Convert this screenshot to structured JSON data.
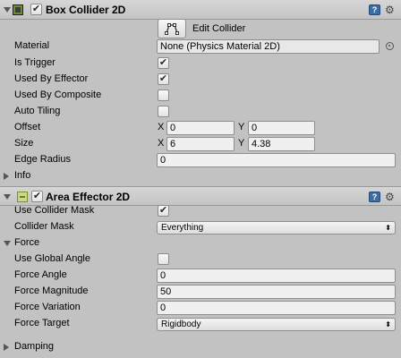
{
  "box_collider": {
    "title": "Box Collider 2D",
    "enabled_check": "✔",
    "edit_collider_label": "Edit Collider",
    "material_label": "Material",
    "material_value": "None (Physics Material 2D)",
    "is_trigger_label": "Is Trigger",
    "is_trigger_check": "✔",
    "used_by_effector_label": "Used By Effector",
    "used_by_effector_check": "✔",
    "used_by_composite_label": "Used By Composite",
    "auto_tiling_label": "Auto Tiling",
    "offset_label": "Offset",
    "offset_x": "0",
    "offset_y": "0",
    "size_label": "Size",
    "size_x": "6",
    "size_y": "4.38",
    "edge_radius_label": "Edge Radius",
    "edge_radius_value": "0",
    "info_label": "Info",
    "axis_x": "X",
    "axis_y": "Y"
  },
  "area_effector": {
    "title": "Area Effector 2D",
    "enabled_check": "✔",
    "use_collider_mask_label": "Use Collider Mask",
    "use_collider_mask_check": "✔",
    "collider_mask_label": "Collider Mask",
    "collider_mask_value": "Everything",
    "force_label": "Force",
    "use_global_angle_label": "Use Global Angle",
    "force_angle_label": "Force Angle",
    "force_angle_value": "0",
    "force_magnitude_label": "Force Magnitude",
    "force_magnitude_value": "50",
    "force_variation_label": "Force Variation",
    "force_variation_value": "0",
    "force_target_label": "Force Target",
    "force_target_value": "Rigidbody",
    "damping_label": "Damping"
  },
  "icons": {
    "book_glyph": "?",
    "gear_glyph": "⚙",
    "dropdown_arrow": "⬍"
  },
  "colors": {
    "panel_bg": "#c2c2c2",
    "field_bg": "#f0f0f0",
    "help_icon": "#3a6ea5"
  }
}
